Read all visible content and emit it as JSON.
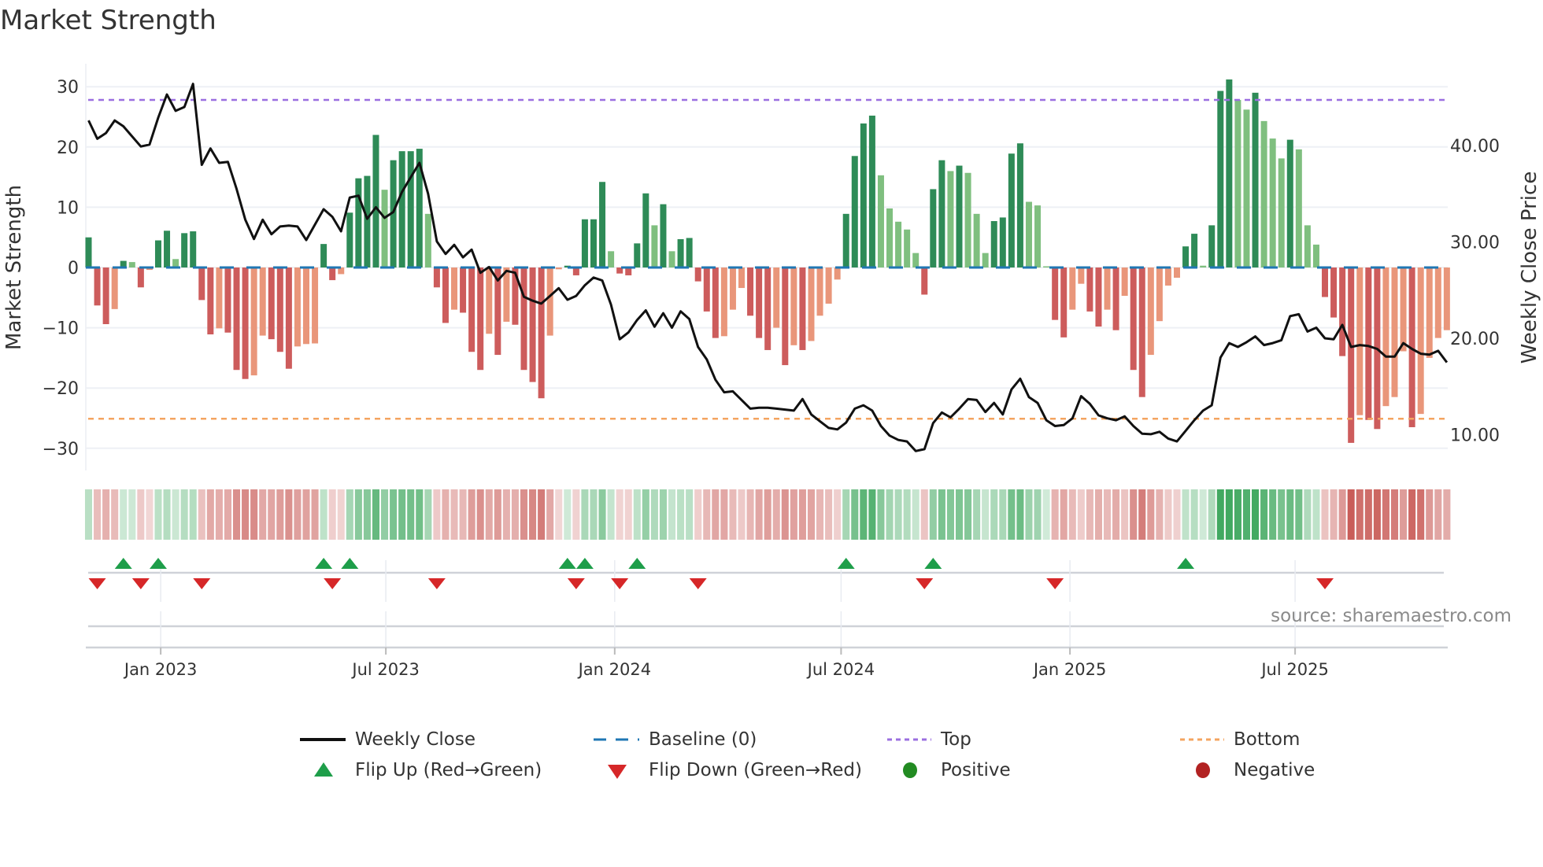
{
  "title": "Market Strength",
  "source": "source: sharemaestro.com",
  "legend": {
    "weekly_close": "Weekly Close",
    "baseline": "Baseline (0)",
    "top": "Top",
    "bottom": "Bottom",
    "flip_up": "Flip Up (Red→Green)",
    "flip_down": "Flip Down (Green→Red)",
    "positive": "Positive",
    "negative": "Negative"
  },
  "colors": {
    "pos_strong": "#2e8b57",
    "pos_weak": "#7fbf7f",
    "neg_strong": "#cd5c5c",
    "neg_weak": "#e9967a",
    "baseline": "#1f77b4",
    "top": "#9b6fe0",
    "bottom": "#f4a460",
    "flip_up": "#1e9e4a",
    "flip_down": "#d62728",
    "positive": "#228b22",
    "negative": "#b22222"
  },
  "chart_data": {
    "type": "bar",
    "title": "Market Strength",
    "ylabel": "Market Strength",
    "y2label": "Weekly Close Price",
    "ylim": [
      -33,
      33
    ],
    "y2lim": [
      7.25,
      48.5
    ],
    "yticks": [
      {
        "v": 30,
        "label": "30"
      },
      {
        "v": 20,
        "label": "20"
      },
      {
        "v": 10,
        "label": "10"
      },
      {
        "v": 0,
        "label": "0"
      },
      {
        "v": -10,
        "label": "−10"
      },
      {
        "v": -20,
        "label": "−20"
      },
      {
        "v": -30,
        "label": "−30"
      }
    ],
    "y2ticks": [
      {
        "v": 40,
        "label": "40.00"
      },
      {
        "v": 30,
        "label": "30.00"
      },
      {
        "v": 20,
        "label": "20.00"
      },
      {
        "v": 10,
        "label": "10.00"
      }
    ],
    "xticks": [
      {
        "date": "2023-01-01",
        "label": "Jan 2023"
      },
      {
        "date": "2023-07-01",
        "label": "Jul 2023"
      },
      {
        "date": "2024-01-01",
        "label": "Jan 2024"
      },
      {
        "date": "2024-07-01",
        "label": "Jul 2024"
      },
      {
        "date": "2025-01-01",
        "label": "Jan 2025"
      },
      {
        "date": "2025-07-01",
        "label": "Jul 2025"
      }
    ],
    "start_date": "2022-11-04",
    "frequency": "weekly",
    "top_level": 27.8,
    "bottom_level": -25.1,
    "strength": [
      5,
      -6.3,
      -9.4,
      -6.9,
      1.1,
      0.9,
      -3.3,
      -0.4,
      4.5,
      6.1,
      1.4,
      5.7,
      6,
      -5.4,
      -11.1,
      -10.1,
      -10.8,
      -17,
      -18.5,
      -17.9,
      -11.3,
      -11.9,
      -14,
      -16.8,
      -13.1,
      -12.7,
      -12.6,
      3.9,
      -2.1,
      -1.1,
      9.1,
      14.8,
      15.2,
      22,
      12.9,
      17.8,
      19.3,
      19.3,
      19.7,
      8.9,
      -3.3,
      -9.2,
      -7,
      -7.5,
      -14,
      -17,
      -11,
      -14.5,
      -9,
      -9.5,
      -17,
      -19,
      -21.7,
      -11.3,
      -0.3,
      0.3,
      -1.3,
      8,
      8,
      14.2,
      2.7,
      -1,
      -1.3,
      4,
      12.3,
      7,
      10.5,
      2.7,
      4.7,
      4.9,
      -2.3,
      -7.3,
      -11.7,
      -11.4,
      -7,
      -3.4,
      -8,
      -11.7,
      -13.7,
      -10,
      -16.2,
      -12.9,
      -13.7,
      -12.2,
      -8,
      -6,
      -2,
      8.9,
      18.5,
      23.9,
      25.2,
      15.3,
      9.8,
      7.6,
      6.3,
      2.4,
      -4.5,
      13,
      17.8,
      16,
      16.9,
      15.7,
      8.9,
      2.4,
      7.7,
      8.3,
      18.9,
      20.6,
      10.9,
      10.3,
      0.2,
      -8.7,
      -11.6,
      -7,
      -2.7,
      -7.3,
      -9.8,
      -7,
      -10.4,
      -4.7,
      -17,
      -21.5,
      -14.5,
      -8.9,
      -3,
      -1.7,
      3.5,
      5.6,
      0.3,
      7,
      29.3,
      31.2,
      27.8,
      26.2,
      29,
      24.3,
      21.4,
      18.1,
      21.2,
      19.6,
      7,
      3.8,
      -4.9,
      -8.3,
      -14.7,
      -29.1,
      -24.5,
      -25.3,
      -26.8,
      -23,
      -21.5,
      -13.9,
      -26.5,
      -24.3,
      -15,
      -11.7,
      -10.4
    ],
    "strengthening": [
      1,
      1,
      1,
      0,
      1,
      0,
      1,
      0,
      1,
      1,
      0,
      1,
      1,
      1,
      1,
      0,
      1,
      1,
      1,
      0,
      0,
      1,
      1,
      1,
      0,
      0,
      0,
      1,
      1,
      0,
      1,
      1,
      1,
      1,
      0,
      1,
      1,
      1,
      1,
      0,
      1,
      1,
      0,
      1,
      1,
      1,
      0,
      1,
      0,
      1,
      1,
      1,
      1,
      0,
      0,
      1,
      1,
      1,
      1,
      1,
      0,
      1,
      1,
      1,
      1,
      0,
      1,
      0,
      1,
      1,
      1,
      1,
      1,
      0,
      0,
      0,
      1,
      1,
      1,
      0,
      1,
      0,
      1,
      0,
      0,
      0,
      0,
      1,
      1,
      1,
      1,
      0,
      0,
      0,
      0,
      0,
      1,
      1,
      1,
      0,
      1,
      0,
      0,
      0,
      1,
      1,
      1,
      1,
      0,
      0,
      0,
      1,
      1,
      0,
      0,
      1,
      1,
      0,
      1,
      0,
      1,
      1,
      0,
      0,
      0,
      0,
      1,
      1,
      0,
      1,
      1,
      1,
      0,
      0,
      1,
      0,
      0,
      0,
      1,
      0,
      0,
      0,
      1,
      1,
      1,
      1,
      0,
      1,
      1,
      0,
      0,
      0,
      1,
      0,
      0,
      0,
      0
    ],
    "weekly_close": [
      42.6,
      40.7,
      41.3,
      42.6,
      42.0,
      40.95,
      39.9,
      40.1,
      42.9,
      45.3,
      43.6,
      44.0,
      46.4,
      38.0,
      39.7,
      38.2,
      38.3,
      35.5,
      32.3,
      30.3,
      32.3,
      30.8,
      31.6,
      31.7,
      31.6,
      30.2,
      31.8,
      33.4,
      32.6,
      31.1,
      34.6,
      34.8,
      32.4,
      33.6,
      32.5,
      33.1,
      35.2,
      36.7,
      38.2,
      35.0,
      30.05,
      28.75,
      29.7,
      28.4,
      29.2,
      26.8,
      27.4,
      26.0,
      27.0,
      26.8,
      24.3,
      23.9,
      23.6,
      24.4,
      25.2,
      24.0,
      24.4,
      25.5,
      26.3,
      26.0,
      23.5,
      19.9,
      20.6,
      21.9,
      22.9,
      21.2,
      22.6,
      21.1,
      22.8,
      22.0,
      19.1,
      17.8,
      15.7,
      14.4,
      14.5,
      13.6,
      12.7,
      12.8,
      12.8,
      12.7,
      12.6,
      12.5,
      13.7,
      12.1,
      11.4,
      10.7,
      10.55,
      11.25,
      12.7,
      13.05,
      12.5,
      10.9,
      9.9,
      9.45,
      9.3,
      8.3,
      8.5,
      11.2,
      12.3,
      11.8,
      12.7,
      13.7,
      13.6,
      12.35,
      13.3,
      12.1,
      14.7,
      15.8,
      13.9,
      13.3,
      11.5,
      10.9,
      11.0,
      11.7,
      14.0,
      13.2,
      12.0,
      11.7,
      11.5,
      11.9,
      10.9,
      10.1,
      10.05,
      10.3,
      9.6,
      9.3,
      10.4,
      11.5,
      12.5,
      13.05,
      18.0,
      19.5,
      19.1,
      19.6,
      20.2,
      19.3,
      19.5,
      19.8,
      22.3,
      22.5,
      20.7,
      21.1,
      20.0,
      19.9,
      21.4,
      19.1,
      19.3,
      19.2,
      18.9,
      18.1,
      18.1,
      19.5,
      18.9,
      18.4,
      18.3,
      18.7,
      17.5
    ],
    "flip_up_weeks": [
      5,
      9,
      28,
      31,
      56,
      58,
      64,
      88,
      98,
      127
    ],
    "flip_down_weeks": [
      2,
      7,
      14,
      29,
      41,
      57,
      62,
      71,
      97,
      112,
      143
    ],
    "grid": true,
    "legend_position": "bottom"
  }
}
